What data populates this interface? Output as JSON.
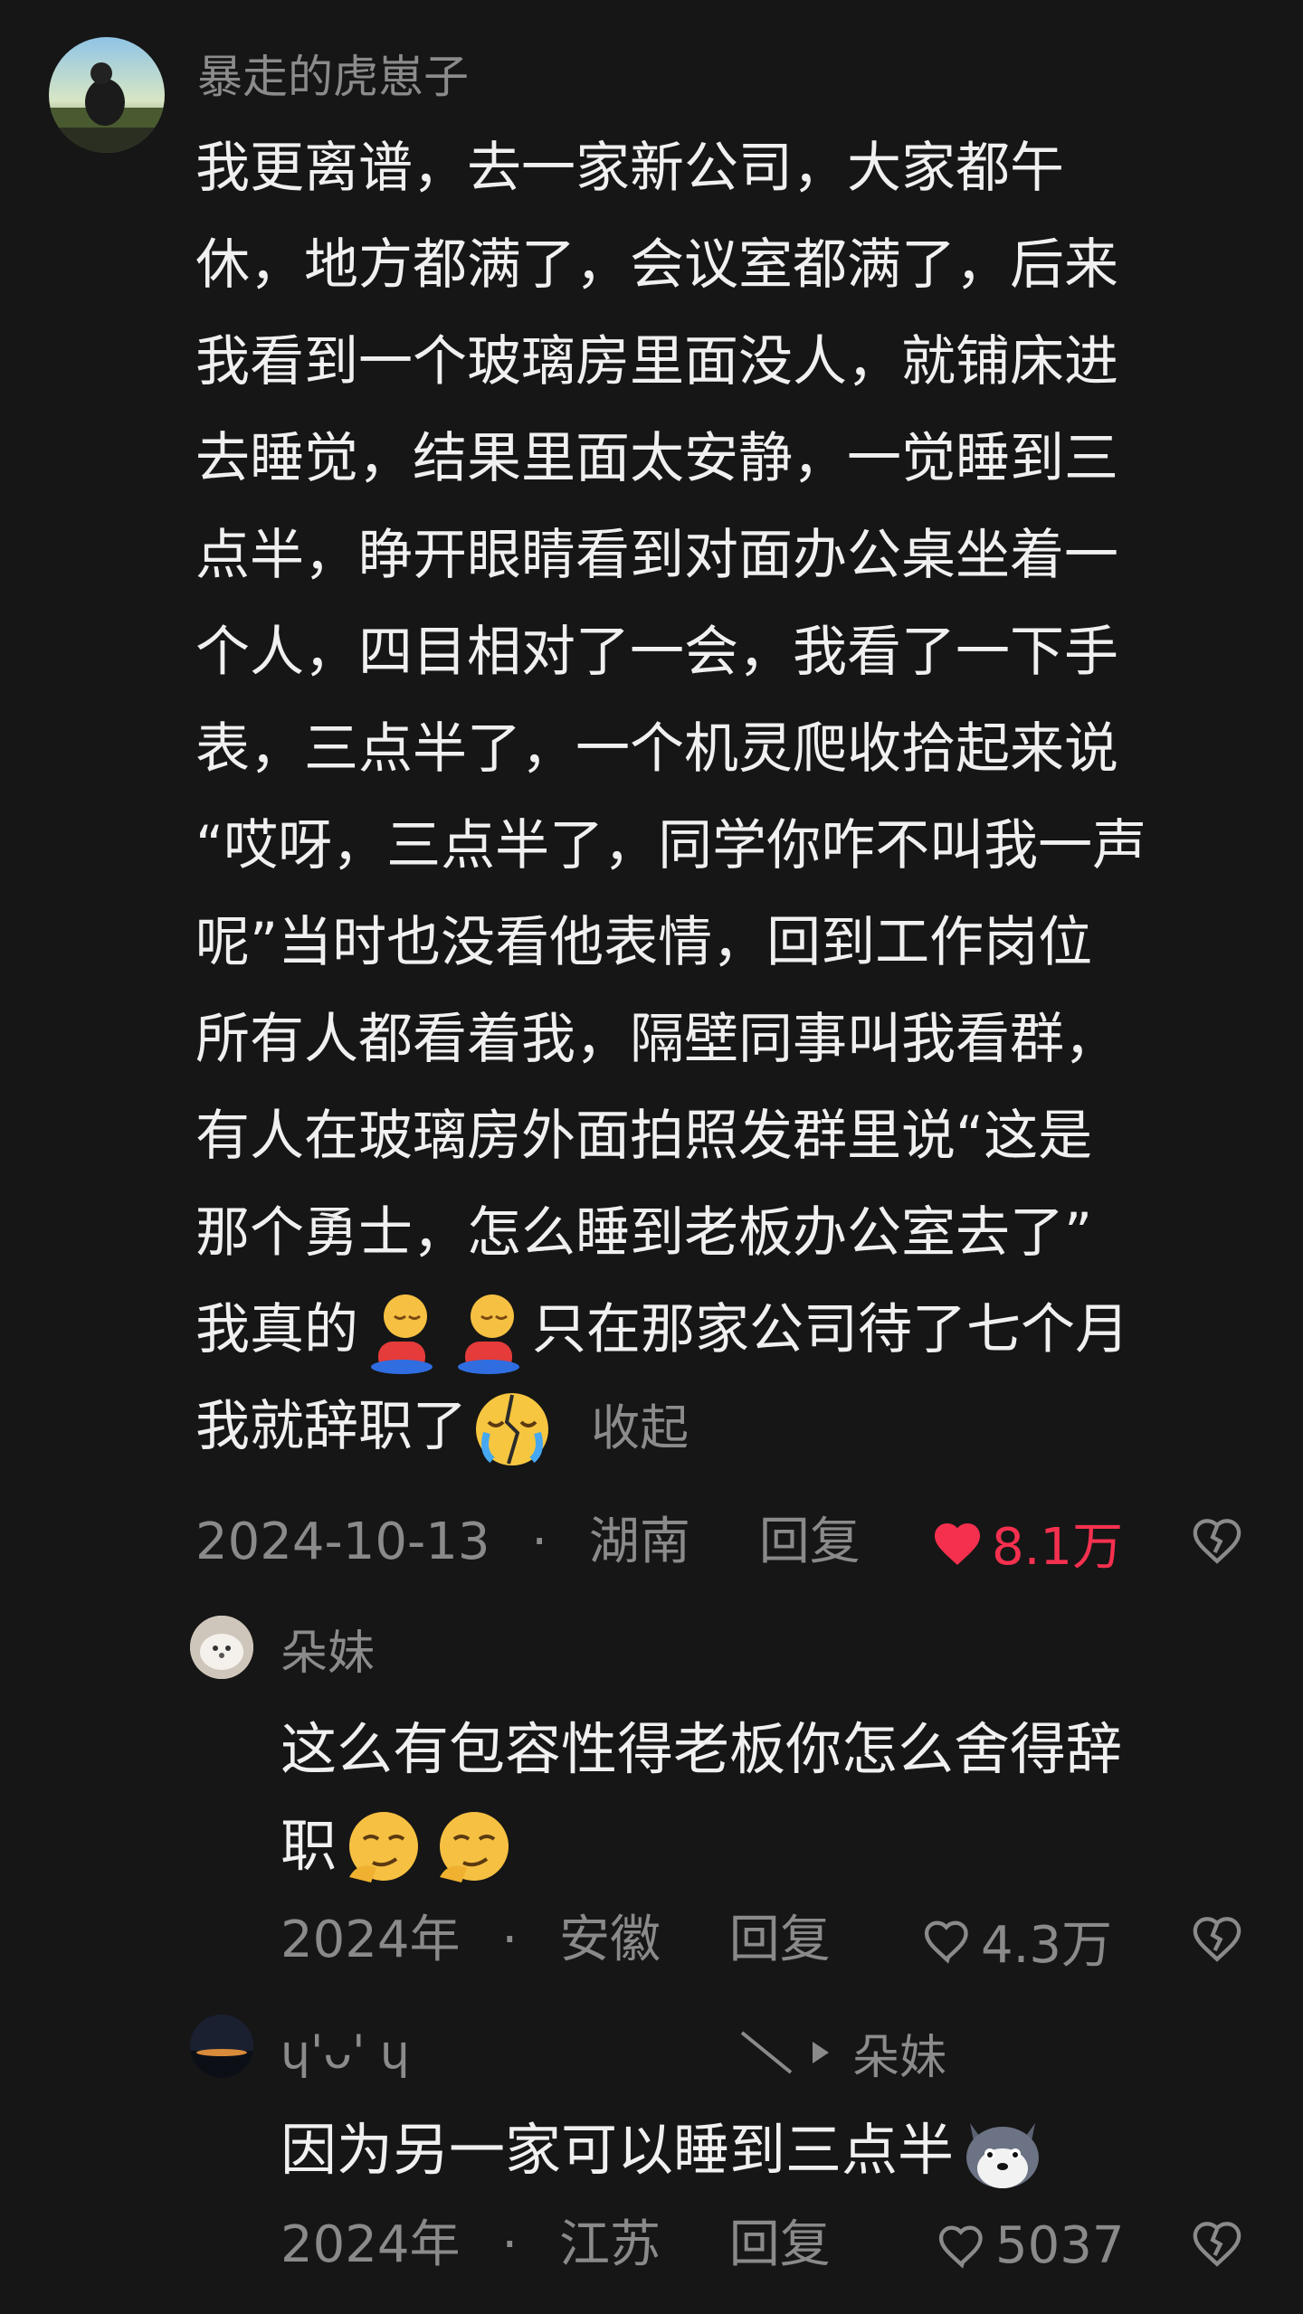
{
  "comment": {
    "username": "暴走的虎崽子",
    "lines": [
      "我更离谱，去一家新公司，大家都午",
      "休，地方都满了，会议室都满了，后来",
      "我看到一个玻璃房里面没人，就铺床进",
      "去睡觉，结果里面太安静，一觉睡到三",
      "点半，睁开眼睛看到对面办公桌坐着一",
      "个人，四目相对了一会，我看了一下手",
      "表，三点半了，一个机灵爬收拾起来说",
      "“哎呀，三点半了，同学你咋不叫我一声",
      "呢”当时也没看他表情，回到工作岗位",
      "所有人都看着我，隔壁同事叫我看群，",
      "有人在玻璃房外面拍照发群里说“这是",
      "那个勇士，怎么睡到老板办公室去了”"
    ],
    "line13_a": "我真的",
    "line13_b": "只在那家公司待了七个月",
    "line14": "我就辞职了",
    "collapse": "收起",
    "date": "2024-10-13",
    "dot": "·",
    "location": "湖南",
    "reply": "回复",
    "likes": "8.1万"
  },
  "reply1": {
    "username": "朵妹",
    "line1": "这么有包容性得老板你怎么舍得辞",
    "line2": "职",
    "date": "2024年",
    "dot": "·",
    "location": "安徽",
    "reply": "回复",
    "likes": "4.3万"
  },
  "reply2": {
    "username": "ɥ'ᴗ' ɥ",
    "target": "朵妹",
    "text": "因为另一家可以睡到三点半",
    "date": "2024年",
    "dot": "·",
    "location": "江苏",
    "reply": "回复",
    "likes": "5037"
  },
  "colors": {
    "background": "#161616",
    "liked_red": "#f5304f",
    "meta_gray": "#8a8a8a"
  },
  "icons": [
    "heart-filled-icon",
    "heart-outline-icon",
    "broken-heart-icon",
    "reply-arrow-icon"
  ]
}
